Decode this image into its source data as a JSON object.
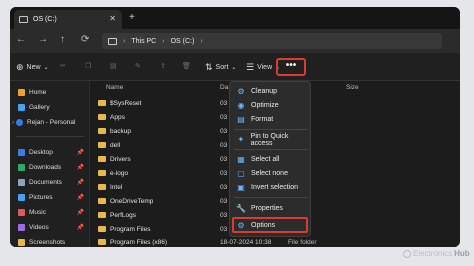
{
  "tab": {
    "title": "OS (C:)",
    "close": "✕",
    "new": "+"
  },
  "nav": {
    "back": "←",
    "forward": "→",
    "up": "↑",
    "refresh": "⟳"
  },
  "address": {
    "crumbs": [
      "This PC",
      "OS (C:)"
    ],
    "separator": "›",
    "chevron": "›"
  },
  "toolbar": {
    "new": "New",
    "sort": "Sort",
    "view": "View",
    "more": "•••"
  },
  "sidebar": {
    "items": [
      {
        "label": "Home",
        "color": "#f0a030"
      },
      {
        "label": "Gallery",
        "color": "#4aa0f0"
      },
      {
        "label": "Rejan - Personal",
        "color": "#2f80ed"
      }
    ],
    "pinned": [
      {
        "label": "Desktop",
        "color": "#3b7de0"
      },
      {
        "label": "Downloads",
        "color": "#2fa86b"
      },
      {
        "label": "Documents",
        "color": "#8fa3c0"
      },
      {
        "label": "Pictures",
        "color": "#4aa0f0"
      },
      {
        "label": "Music",
        "color": "#e05a5a"
      },
      {
        "label": "Videos",
        "color": "#9d6ce0"
      },
      {
        "label": "Screenshots",
        "color": "#e8b84b"
      }
    ]
  },
  "columns": {
    "name": "Name",
    "date": "Da",
    "size": "Size"
  },
  "files": [
    {
      "name": "$SysReset",
      "date": "03"
    },
    {
      "name": "Apps",
      "date": "03"
    },
    {
      "name": "backup",
      "date": "03"
    },
    {
      "name": "dell",
      "date": "03"
    },
    {
      "name": "Drivers",
      "date": "03"
    },
    {
      "name": "e-logo",
      "date": "03"
    },
    {
      "name": "Intel",
      "date": "03"
    },
    {
      "name": "OneDriveTemp",
      "date": "03"
    },
    {
      "name": "PerfLogs",
      "date": "03"
    },
    {
      "name": "Program Files",
      "date": "03"
    },
    {
      "name": "Program Files (x86)",
      "date": "18-07-2024 10:38",
      "type": "File folder"
    }
  ],
  "menu": {
    "items": [
      {
        "label": "Cleanup",
        "icon": "⚙"
      },
      {
        "label": "Optimize",
        "icon": "◉"
      },
      {
        "label": "Format",
        "icon": "▤"
      },
      {
        "label": "Pin to Quick access",
        "icon": "✦"
      },
      {
        "label": "Select all",
        "icon": "▦"
      },
      {
        "label": "Select none",
        "icon": "▢"
      },
      {
        "label": "Invert selection",
        "icon": "▣"
      },
      {
        "label": "Properties",
        "icon": "🔧"
      },
      {
        "label": "Options",
        "icon": "⚙"
      }
    ]
  },
  "watermark": {
    "brand": "Electronics",
    "bold": "Hub"
  },
  "colors": {
    "highlight": "#d93b35",
    "folder": "#e8b84b"
  }
}
